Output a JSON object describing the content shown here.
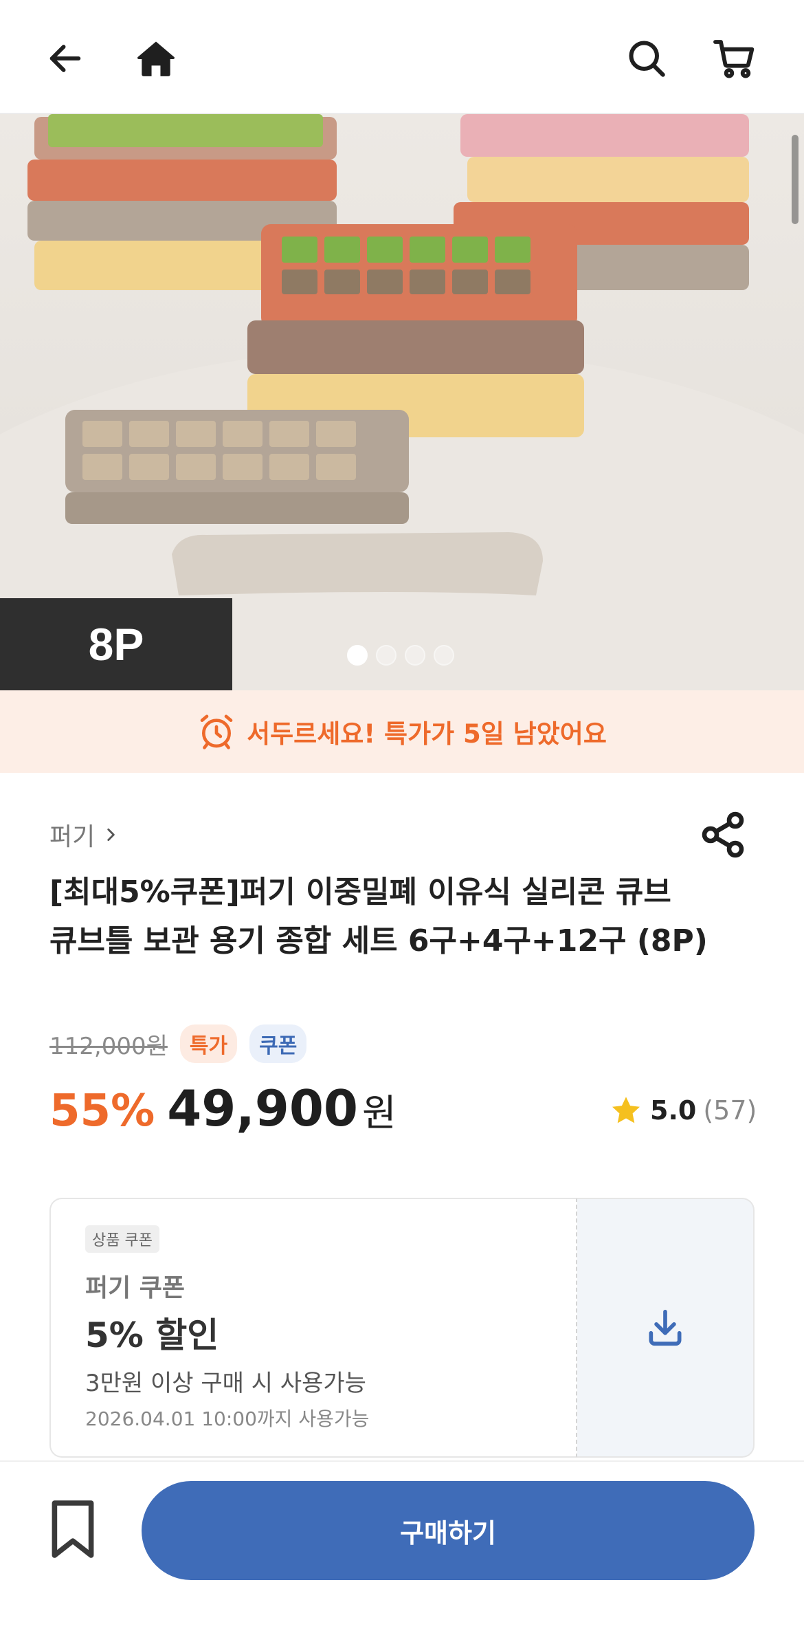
{
  "header": {
    "back_icon": "back-arrow-icon",
    "home_icon": "home-icon",
    "search_icon": "search-icon",
    "cart_icon": "cart-icon"
  },
  "hero": {
    "badge": "8P",
    "page_count": 4,
    "active_page": 1
  },
  "hurry_banner": {
    "icon": "alarm-clock-icon",
    "text": "서두르세요! 특가가 5일 남았어요"
  },
  "product": {
    "brand": "퍼기",
    "title": "[최대5%쿠폰]퍼기 이중밀폐 이유식 실리콘 큐브 큐브틀 보관 용기 종합 세트 6구+4구+12구 (8P)",
    "original_price": "112,000원",
    "tags": [
      "특가",
      "쿠폰"
    ],
    "discount": "55%",
    "price": "49,900",
    "currency": "원",
    "rating": "5.0",
    "review_count": "(57)"
  },
  "coupon": {
    "label": "상품 쿠폰",
    "brand": "퍼기 쿠폰",
    "amount": "5% 할인",
    "condition": "3만원 이상 구매 시 사용가능",
    "expiry": "2026.04.01 10:00까지 사용가능"
  },
  "bottom_bar": {
    "buy_label": "구매하기"
  },
  "colors": {
    "accent_orange": "#ee6a2b",
    "brand_blue": "#3f6cb8",
    "banner_bg": "#fdeee6"
  }
}
